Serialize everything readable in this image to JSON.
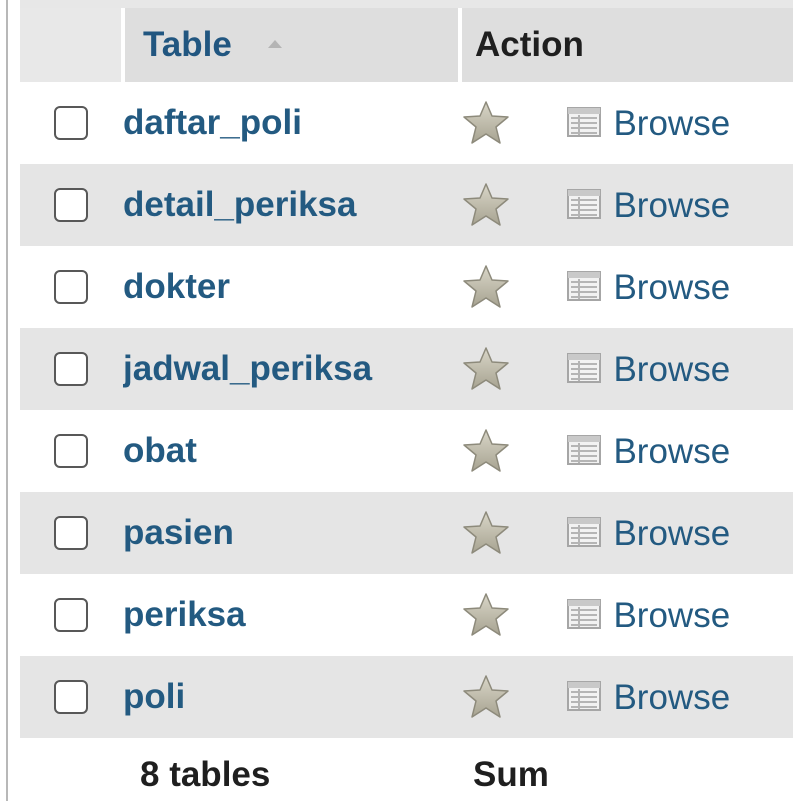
{
  "header": {
    "table_label": "Table",
    "action_label": "Action"
  },
  "rows": [
    {
      "name": "daftar_poli",
      "browse_label": "Browse"
    },
    {
      "name": "detail_periksa",
      "browse_label": "Browse"
    },
    {
      "name": "dokter",
      "browse_label": "Browse"
    },
    {
      "name": "jadwal_periksa",
      "browse_label": "Browse"
    },
    {
      "name": "obat",
      "browse_label": "Browse"
    },
    {
      "name": "pasien",
      "browse_label": "Browse"
    },
    {
      "name": "periksa",
      "browse_label": "Browse"
    },
    {
      "name": "poli",
      "browse_label": "Browse"
    }
  ],
  "footer": {
    "count_label": "8 tables",
    "sum_label": "Sum"
  },
  "icons": {
    "sort": "sort-ascending-icon",
    "favorite": "star-icon",
    "browse": "table-icon"
  },
  "colors": {
    "link": "#235a81",
    "row_alt": "#e5e5e5",
    "header_bg": "#dedede"
  }
}
